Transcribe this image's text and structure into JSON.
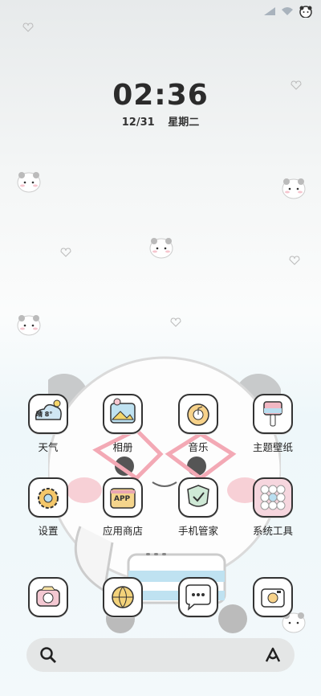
{
  "lockscreen": {
    "time": "02:36",
    "date": "12/31",
    "weekday": "星期二"
  },
  "weather_badge": "晴 8°",
  "apps_row1": [
    {
      "label": "天气",
      "icon": "weather-icon"
    },
    {
      "label": "相册",
      "icon": "gallery-icon"
    },
    {
      "label": "音乐",
      "icon": "music-icon"
    },
    {
      "label": "主题壁纸",
      "icon": "theme-wallpaper-icon"
    }
  ],
  "apps_row2": [
    {
      "label": "设置",
      "icon": "settings-icon"
    },
    {
      "label": "应用商店",
      "icon": "app-store-icon"
    },
    {
      "label": "手机管家",
      "icon": "phone-manager-icon"
    },
    {
      "label": "系统工具",
      "icon": "system-tools-folder-icon"
    }
  ],
  "dock": [
    {
      "icon": "camera-icon"
    },
    {
      "icon": "browser-icon"
    },
    {
      "icon": "messages-icon"
    },
    {
      "icon": "photo-camera-icon"
    }
  ],
  "app_store_badge": "APP",
  "colors": {
    "accent_pink": "#f2c6d0",
    "outline": "#333333",
    "search_bg": "#e4e6e6"
  }
}
